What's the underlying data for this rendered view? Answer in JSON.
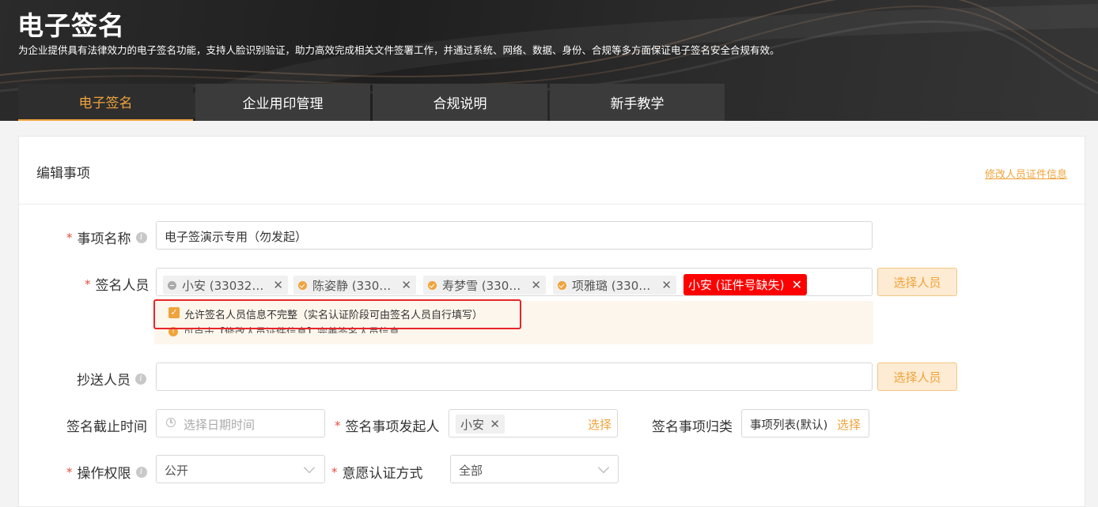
{
  "header": {
    "title": "电子签名",
    "subtitle": "为企业提供具有法律效力的电子签名功能，支持人脸识别验证，助力高效完成相关文件签署工作，并通过系统、网络、数据、身份、合规等多方面保证电子签名安全合规有效。"
  },
  "tabs": [
    {
      "label": "电子签名",
      "active": true
    },
    {
      "label": "企业用印管理",
      "active": false
    },
    {
      "label": "合规说明",
      "active": false
    },
    {
      "label": "新手教学",
      "active": false
    }
  ],
  "card": {
    "title": "编辑事项",
    "edit_link": "修改人员证件信息"
  },
  "form": {
    "item_name": {
      "label": "事项名称",
      "value": "电子签演示专用（勿发起）"
    },
    "signers": {
      "label": "签名人员",
      "tags": [
        {
          "text": "小安 (33032…",
          "status": "minus"
        },
        {
          "text": "陈姿静 (330…",
          "status": "check"
        },
        {
          "text": "寿梦雪 (330…",
          "status": "check"
        },
        {
          "text": "项雅璐 (330…",
          "status": "check"
        }
      ],
      "error_tag": "小安 (证件号缺失)",
      "select_button": "选择人员",
      "allow_incomplete": "允许签名人员信息不完整（实名认证阶段可由签名人员自行填写）",
      "hint": "可点击【修改人员证件信息】完善签名人员信息"
    },
    "cc": {
      "label": "抄送人员",
      "select_button": "选择人员"
    },
    "deadline": {
      "label": "签名截止时间",
      "placeholder": "选择日期时间"
    },
    "initiator": {
      "label": "签名事项发起人",
      "tag": "小安",
      "select": "选择"
    },
    "category": {
      "label": "签名事项归类",
      "value": "事项列表(默认)",
      "select": "选择"
    },
    "permission": {
      "label": "操作权限",
      "value": "公开"
    },
    "auth_method": {
      "label": "意愿认证方式",
      "value": "全部"
    }
  },
  "colors": {
    "accent": "#f0a33a",
    "error": "#ff0000",
    "required": "#e84c3d"
  }
}
